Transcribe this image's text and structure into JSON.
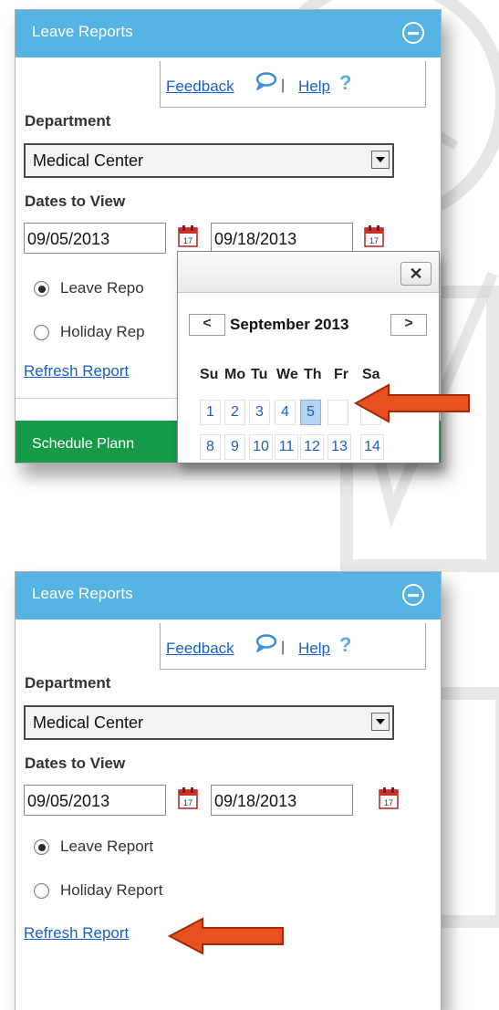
{
  "top_panel": {
    "title": "Leave Reports",
    "feedback_link": "Feedback",
    "separator": "|",
    "help_link": "Help",
    "help_icon": "?",
    "department_label": "Department",
    "department_value": "Medical Center",
    "dates_label": "Dates to View",
    "start_date": "09/05/2013",
    "end_date": "09/18/2013",
    "radio_leave_label": "Leave Repo",
    "radio_holiday_label": "Holiday Rep",
    "refresh_link": "Refresh Report",
    "schedule_bar_label": "Schedule Plann"
  },
  "calendar": {
    "close_label": "✕",
    "prev_label": "<",
    "next_label": ">",
    "month_label": "September 2013",
    "weekdays": [
      "Su",
      "Mo",
      "Tu",
      "We",
      "Th",
      "Fr",
      "Sa"
    ],
    "row1": [
      "1",
      "2",
      "3",
      "4",
      "5"
    ],
    "row2": [
      "8",
      "9",
      "10",
      "11",
      "12",
      "13",
      "14"
    ],
    "selected_day": "5"
  },
  "bottom_panel": {
    "title": "Leave Reports",
    "feedback_link": "Feedback",
    "separator": "|",
    "help_link": "Help",
    "help_icon": "?",
    "department_label": "Department",
    "department_value": "Medical Center",
    "dates_label": "Dates to View",
    "start_date": "09/05/2013",
    "end_date": "09/18/2013",
    "radio_leave_label": "Leave Report",
    "radio_holiday_label": "Holiday Report",
    "refresh_link": "Refresh Report"
  },
  "colors": {
    "header_blue": "#56b4e3",
    "link_blue": "#1a5fbf",
    "schedule_green": "#159a47",
    "arrow_red": "#e8501f",
    "selected_day": "#b3d4f3"
  },
  "icons": [
    "minus-circle-icon",
    "speech-bubble-icon",
    "question-icon",
    "calendar-icon",
    "dropdown-arrow-icon",
    "close-icon",
    "red-arrow-icon"
  ]
}
